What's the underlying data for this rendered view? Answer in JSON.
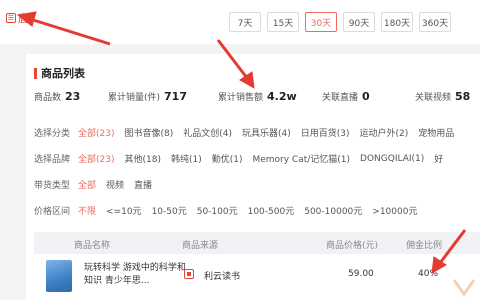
{
  "brand": {
    "glyph": "☰",
    "text": "鹿"
  },
  "day_tabs": [
    "7天",
    "15天",
    "30天",
    "90天",
    "180天",
    "360天"
  ],
  "active_tab": "30天",
  "section_title": "商品列表",
  "stats": [
    {
      "label": "商品数",
      "value": "23"
    },
    {
      "label": "累计销量(件)",
      "value": "717"
    },
    {
      "label": "累计销售额",
      "value": "4.2w"
    },
    {
      "label": "关联直播",
      "value": "0"
    },
    {
      "label": "关联视频",
      "value": "58"
    }
  ],
  "filters": {
    "category": {
      "label": "选择分类",
      "options": [
        "全部(23)",
        "图书音像(8)",
        "礼品文创(4)",
        "玩具乐器(4)",
        "日用百货(3)",
        "运动户外(2)",
        "宠物用品"
      ]
    },
    "brand": {
      "label": "选择品牌",
      "options": [
        "全部(23)",
        "其他(18)",
        "韩纯(1)",
        "勤优(1)",
        "Memory Cat/记忆猫(1)",
        "DONGQILAI(1)",
        "好"
      ]
    },
    "delivery": {
      "label": "带货类型",
      "options": [
        "全部",
        "视频",
        "直播"
      ]
    },
    "price": {
      "label": "价格区间",
      "options": [
        "不限",
        "<=10元",
        "10-50元",
        "50-100元",
        "100-500元",
        "500-10000元",
        ">10000元"
      ]
    }
  },
  "table": {
    "headers": [
      "商品名称",
      "商品来源",
      "商品价格(元)",
      "佣金比例"
    ],
    "rows": [
      {
        "name": "玩转科学 游戏中的科学和知识 青少年思...",
        "source": "利云读书",
        "price": "59.00",
        "commission": "40%"
      }
    ]
  },
  "colors": {
    "accent": "#ef6b5f",
    "arrow": "#e33b2f"
  }
}
